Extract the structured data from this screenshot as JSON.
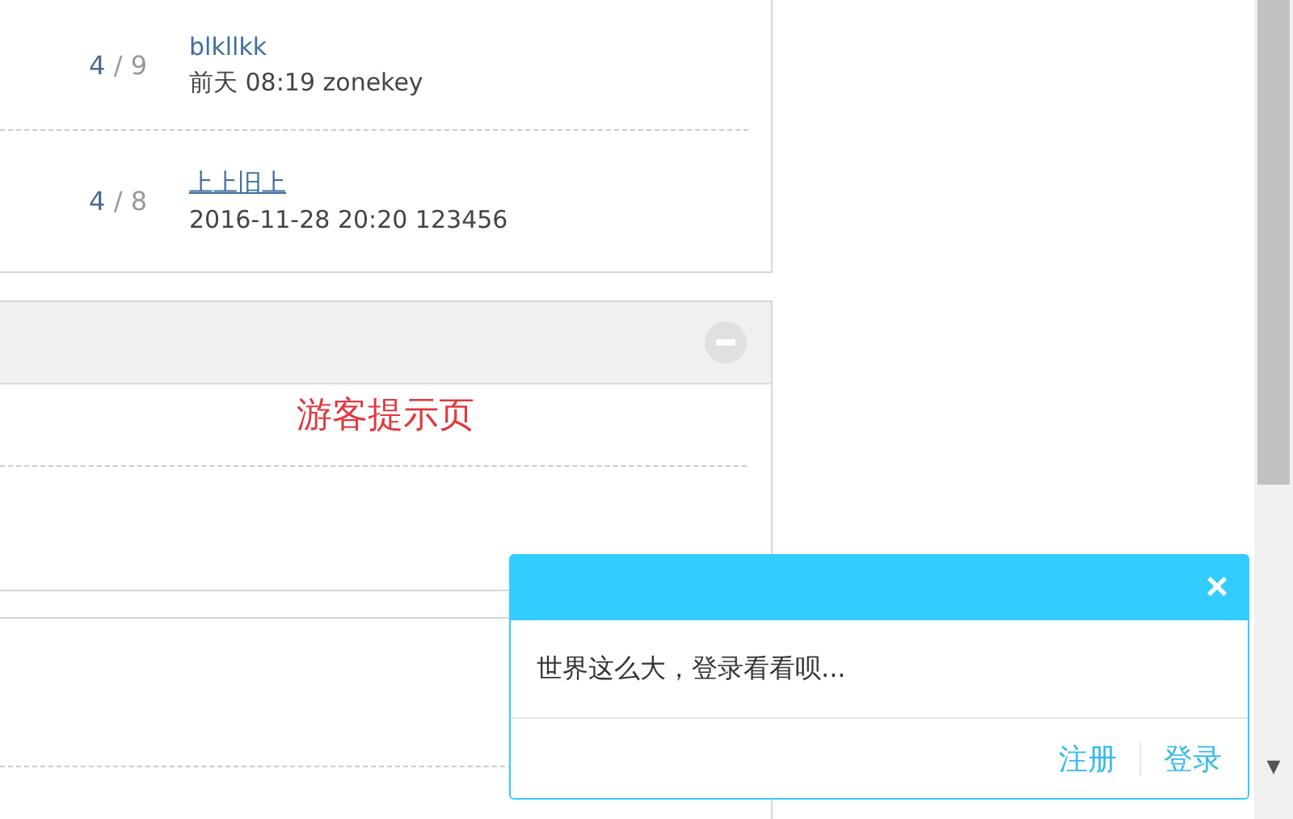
{
  "topics": [
    {
      "replies": "4",
      "separator": "/",
      "views": "9",
      "title": "blkllkk",
      "meta": "前天 08:19 zonekey"
    },
    {
      "replies": "4",
      "separator": "/",
      "views": "8",
      "title": "上上旧上",
      "meta": "2016-11-28 20:20 123456"
    }
  ],
  "guest_panel": {
    "expanded": true,
    "notice": "游客提示页"
  },
  "popup": {
    "close": "×",
    "message": "世界这么大，登录看看呗...",
    "links": [
      "注册",
      "登录"
    ]
  },
  "scrollbar": {
    "arrow": "▼"
  }
}
